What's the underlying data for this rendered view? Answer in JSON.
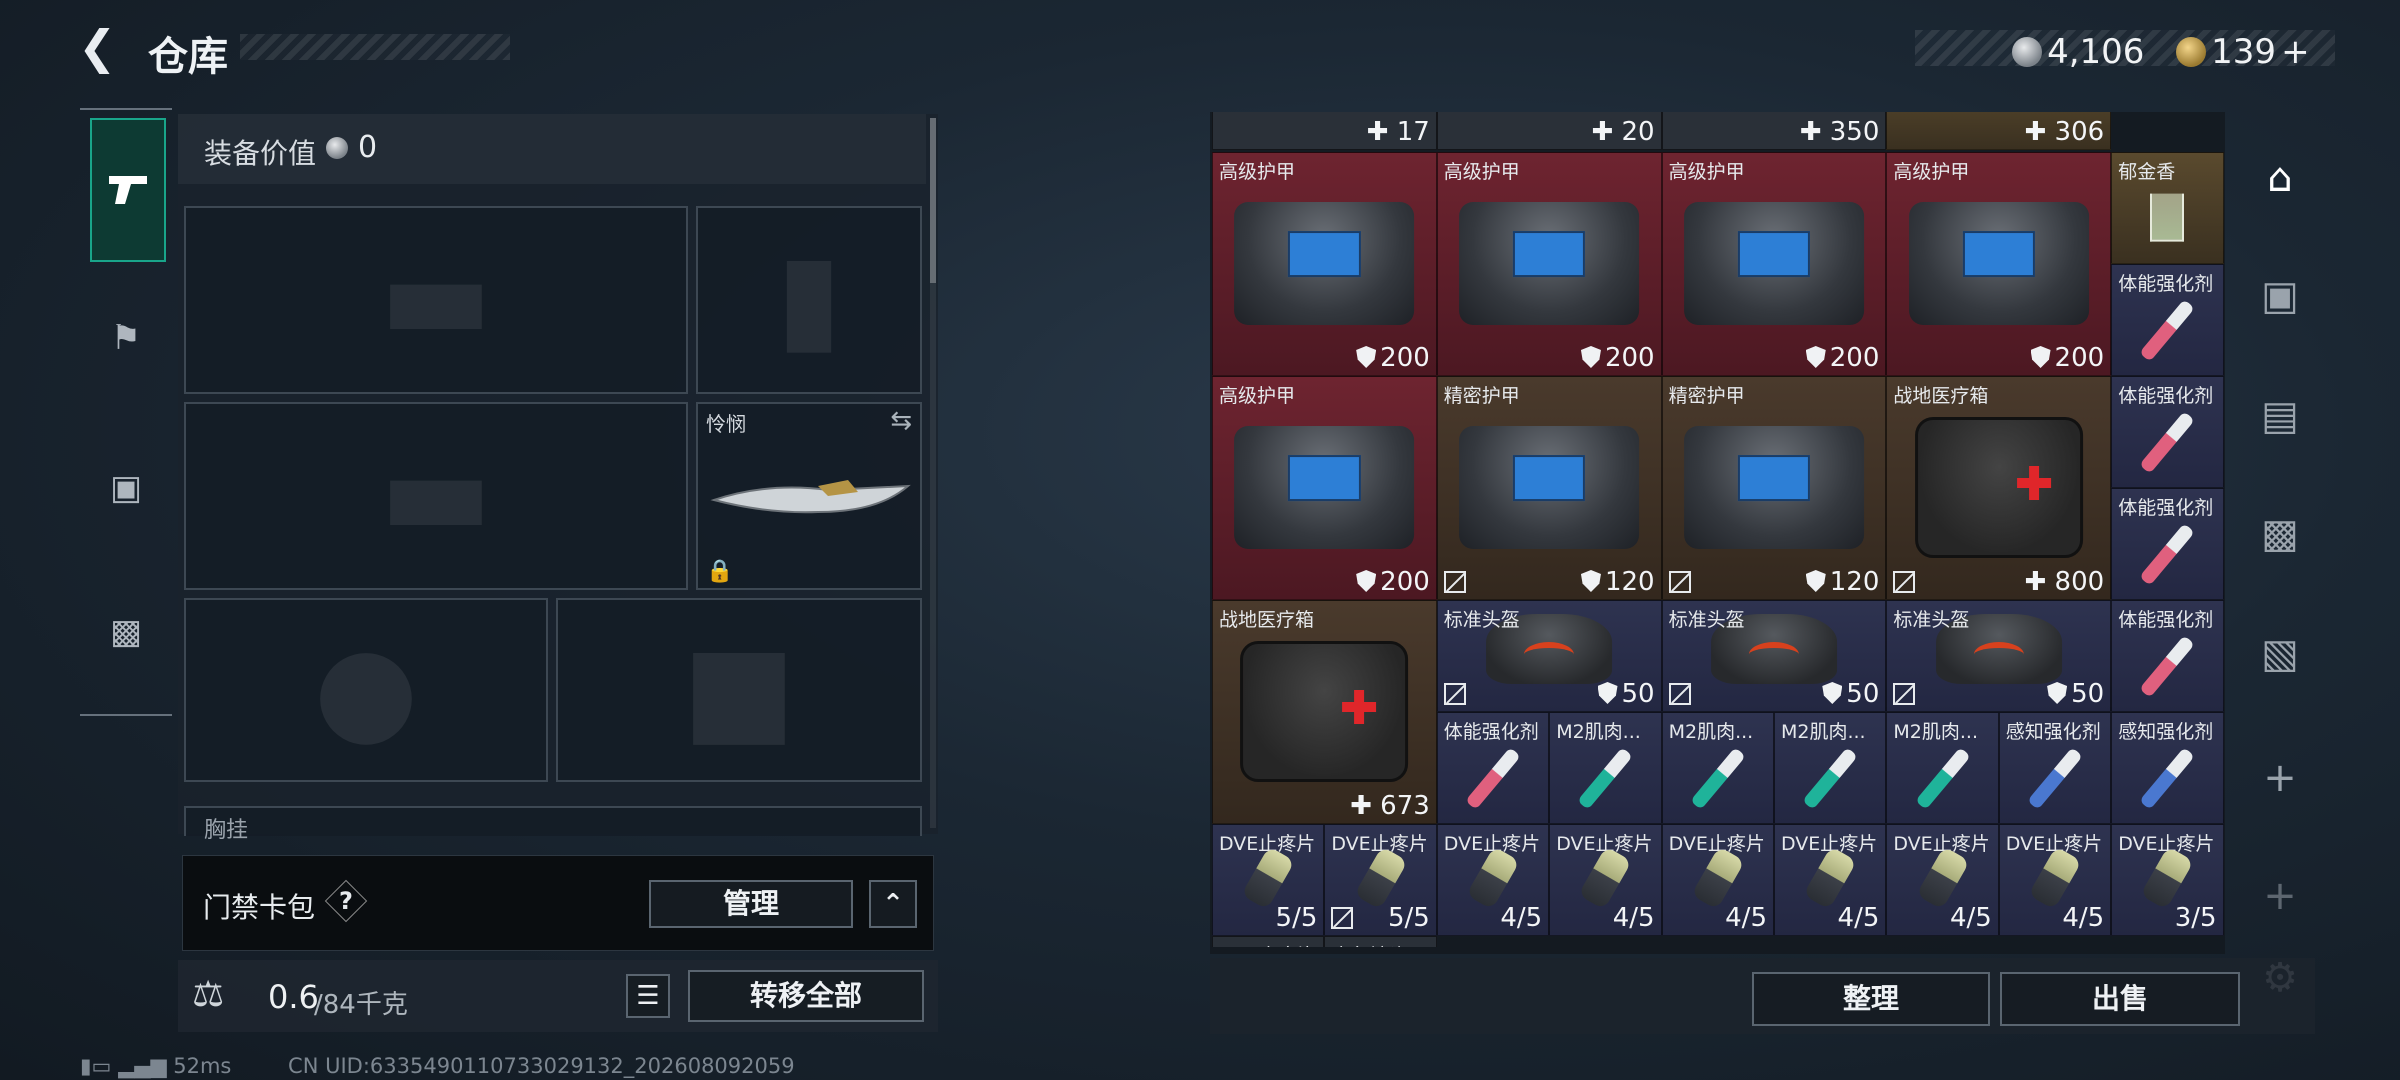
{
  "header": {
    "title": "仓库",
    "currency_silver": "4,106",
    "currency_gold": "139",
    "add_symbol": "+"
  },
  "equipment": {
    "label": "装备价值",
    "value": "0",
    "knife_name": "怜悯",
    "chest_rig_label": "胸挂"
  },
  "keycard": {
    "label": "门禁卡包",
    "help": "?",
    "manage_label": "管理"
  },
  "weight": {
    "current": "0.6",
    "capacity": "/84千克"
  },
  "transfer_label": "转移全部",
  "stash": {
    "top_row": [
      "17",
      "20",
      "350",
      "306"
    ],
    "rows": [
      [
        {
          "name": "高级护甲",
          "value": "200",
          "kind": "bag",
          "color": "red",
          "icon": "shield"
        },
        {
          "name": "高级护甲",
          "value": "200",
          "kind": "bag",
          "color": "red",
          "icon": "shield"
        },
        {
          "name": "高级护甲",
          "value": "200",
          "kind": "bag",
          "color": "red",
          "icon": "shield"
        },
        {
          "name": "高级护甲",
          "value": "200",
          "kind": "bag",
          "color": "red",
          "icon": "shield"
        },
        {
          "name": "郁金香",
          "value": "",
          "kind": "glass",
          "color": "gold",
          "icon": ""
        }
      ],
      [
        {
          "name": "高级护甲",
          "value": "200",
          "kind": "bag",
          "color": "red",
          "icon": "shield"
        },
        {
          "name": "精密护甲",
          "value": "120",
          "kind": "bag2",
          "color": "brown",
          "icon": "shield",
          "nodrop": true
        },
        {
          "name": "精密护甲",
          "value": "120",
          "kind": "bag2",
          "color": "brown",
          "icon": "shield",
          "nodrop": true
        },
        {
          "name": "战地医疗箱",
          "value": "800",
          "kind": "medkit",
          "color": "brown",
          "icon": "plus",
          "nodrop": true
        }
      ],
      [
        {
          "name": "战地医疗箱",
          "value": "673",
          "kind": "medkit",
          "color": "brown",
          "icon": "plus"
        },
        {
          "name": "标准头盔",
          "value": "50",
          "kind": "helmet",
          "color": "purple",
          "icon": "shield",
          "nodrop": true
        },
        {
          "name": "标准头盔",
          "value": "50",
          "kind": "helmet",
          "color": "purple",
          "icon": "shield",
          "nodrop": true
        },
        {
          "name": "标准头盔",
          "value": "50",
          "kind": "helmet",
          "color": "purple",
          "icon": "shield",
          "nodrop": true
        }
      ],
      [
        {
          "name": "体能强化剂",
          "color_hex": "#e0607e"
        },
        {
          "name": "M2肌肉...",
          "color_hex": "#1fb39a"
        },
        {
          "name": "M2肌肉...",
          "color_hex": "#1fb39a"
        },
        {
          "name": "M2肌肉...",
          "color_hex": "#1fb39a"
        },
        {
          "name": "M2肌肉...",
          "color_hex": "#1fb39a"
        },
        {
          "name": "感知强化剂",
          "color_hex": "#4a78d0"
        },
        {
          "name": "感知强化剂",
          "color_hex": "#4a78d0"
        }
      ],
      [
        {
          "name": "DVE止疼片",
          "value": "5/5"
        },
        {
          "name": "DVE止疼片",
          "value": "5/5",
          "nodrop": true
        },
        {
          "name": "DVE止疼片",
          "value": "4/5"
        },
        {
          "name": "DVE止疼片",
          "value": "4/5"
        },
        {
          "name": "DVE止疼片",
          "value": "4/5"
        },
        {
          "name": "DVE止疼片",
          "value": "4/5"
        },
        {
          "name": "DVE止疼片",
          "value": "4/5"
        },
        {
          "name": "DVE止疼片",
          "value": "4/5"
        },
        {
          "name": "DVE止疼片",
          "value": "3/5"
        }
      ],
      [
        {
          "name": "DVE止疼片"
        },
        {
          "name": "广角镜头"
        }
      ]
    ],
    "right_column": [
      "体能强化剂",
      "体能强化剂",
      "体能强化剂",
      "体能强化剂"
    ]
  },
  "actions": {
    "organize": "整理",
    "sell": "出售"
  },
  "status": {
    "ping": "52ms",
    "uid": "CN UID:6335490110733029132_202608092059"
  },
  "colors": {
    "accent": "#19a58a",
    "rare_red": "#6e2430",
    "rare_brown": "#4a3a2c",
    "rare_purple": "#2e3350"
  }
}
